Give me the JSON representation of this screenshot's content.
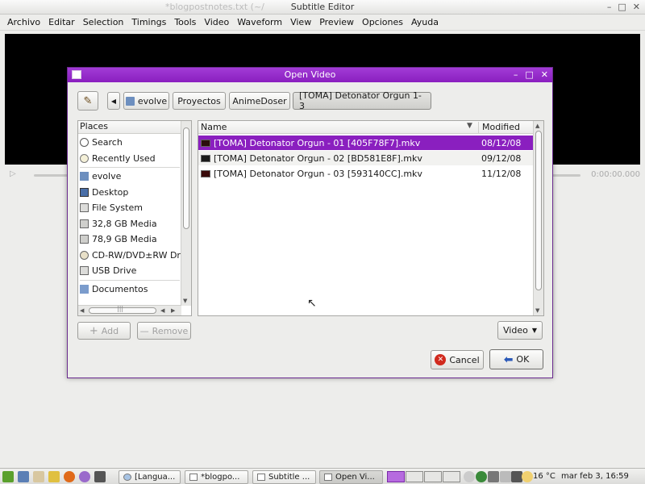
{
  "app": {
    "title": "Subtitle Editor",
    "ghost_title": "*blogpostnotes.txt (~/",
    "ctrl_min": "–",
    "ctrl_max": "□",
    "ctrl_close": "✕",
    "menu": [
      "Archivo",
      "Editar",
      "Selection",
      "Timings",
      "Tools",
      "Video",
      "Waveform",
      "View",
      "Preview",
      "Opciones",
      "Ayuda"
    ],
    "time_readout": "0:00:00.000",
    "play_glyph": "▷"
  },
  "dialog": {
    "title": "Open Video",
    "ctrl_min": "–",
    "ctrl_max": "□",
    "ctrl_close": "✕",
    "back_glyph": "◀",
    "breadcrumbs": [
      "evolve",
      "Proyectos",
      "AnimeDoser",
      "[TOMA] Detonator Orgun 1-3"
    ],
    "places_header": "Places",
    "places": [
      {
        "label": "Search",
        "icon": "search-icon"
      },
      {
        "label": "Recently Used",
        "icon": "clock-icon"
      },
      {
        "label": "evolve",
        "icon": "home-folder-icon"
      },
      {
        "label": "Desktop",
        "icon": "desktop-icon"
      },
      {
        "label": "File System",
        "icon": "harddisk-icon"
      },
      {
        "label": "32,8 GB Media",
        "icon": "drive-icon"
      },
      {
        "label": "78,9 GB Media",
        "icon": "drive-icon"
      },
      {
        "label": "CD-RW/DVD±RW Drive",
        "icon": "optical-drive-icon"
      },
      {
        "label": "USB Drive",
        "icon": "usb-drive-icon"
      },
      {
        "label": "Documentos",
        "icon": "folder-icon"
      }
    ],
    "hscroll_grip": "|||",
    "files_header": {
      "name": "Name",
      "modified": "Modified",
      "sort_glyph": "▼"
    },
    "files": [
      {
        "name": "[TOMA] Detonator Orgun - 01 [405F78F7].mkv",
        "modified": "08/12/08"
      },
      {
        "name": "[TOMA] Detonator Orgun - 02 [BD581E8F].mkv",
        "modified": "09/12/08"
      },
      {
        "name": "[TOMA] Detonator Orgun - 03 [593140CC].mkv",
        "modified": "11/12/08"
      }
    ],
    "add_label": "Add",
    "remove_label": "Remove",
    "filter_value": "Video",
    "filter_arrow": "▼",
    "cancel_label": "Cancel",
    "ok_label": "OK",
    "cancel_badge": "✕",
    "ok_arrow": "⬅",
    "add_glyph": "+",
    "remove_glyph": "—",
    "edit_glyph": "✎"
  },
  "taskbar": {
    "tasks": [
      "[Langua...",
      "*blogpo...",
      "Subtitle ...",
      "Open Vi..."
    ],
    "weather": "16 °C",
    "clock": "mar feb  3, 16:59"
  },
  "colors": {
    "accent": "#8a1fbf",
    "titlebar": "#9b31cf",
    "cancel_red": "#d12a1e",
    "ok_blue": "#2a59b8"
  }
}
